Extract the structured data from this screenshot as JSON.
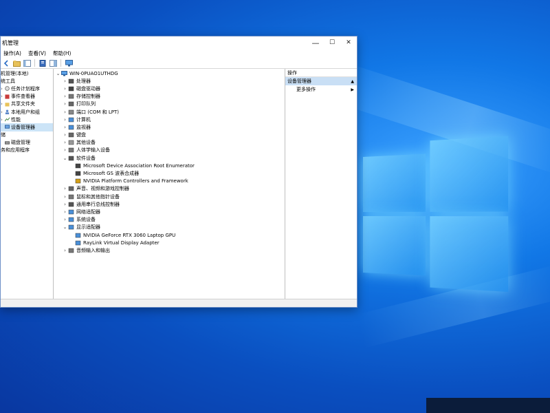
{
  "window": {
    "title": "机管理",
    "controls": {
      "minimize": "—",
      "maximize": "☐",
      "close": "✕"
    }
  },
  "menu": [
    {
      "label": "操作(A)"
    },
    {
      "label": "查看(V)"
    },
    {
      "label": "帮助(H)"
    }
  ],
  "toolbar": [
    "back-icon",
    "forward-icon",
    "up-folder-icon",
    "properties-icon",
    "help-icon",
    "show-hide-icon"
  ],
  "nav_tree": [
    {
      "label": "机管理(本地)",
      "indent": 0
    },
    {
      "label": "统工具",
      "indent": 0
    },
    {
      "label": "任务计划程序",
      "indent": 1
    },
    {
      "label": "事件查看器",
      "indent": 1
    },
    {
      "label": "共享文件夹",
      "indent": 1
    },
    {
      "label": "本地用户和组",
      "indent": 1
    },
    {
      "label": "性能",
      "indent": 1
    },
    {
      "label": "设备管理器",
      "indent": 1,
      "selected": true
    },
    {
      "label": "储",
      "indent": 0
    },
    {
      "label": "磁盘管理",
      "indent": 1
    },
    {
      "label": "务和应用程序",
      "indent": 0
    }
  ],
  "device_tree": {
    "root": "WIN-0PUAO1UTHDG",
    "items": [
      {
        "label": "处理器",
        "level": 1,
        "expanded": false
      },
      {
        "label": "磁盘驱动器",
        "level": 1,
        "expanded": false
      },
      {
        "label": "存储控制器",
        "level": 1,
        "expanded": false
      },
      {
        "label": "打印队列",
        "level": 1,
        "expanded": false
      },
      {
        "label": "端口 (COM 和 LPT)",
        "level": 1,
        "expanded": false
      },
      {
        "label": "计算机",
        "level": 1,
        "expanded": false
      },
      {
        "label": "监视器",
        "level": 1,
        "expanded": false
      },
      {
        "label": "键盘",
        "level": 1,
        "expanded": false
      },
      {
        "label": "其他设备",
        "level": 1,
        "expanded": false
      },
      {
        "label": "人体学输入设备",
        "level": 1,
        "expanded": false
      },
      {
        "label": "软件设备",
        "level": 1,
        "expanded": true
      },
      {
        "label": "Microsoft Device Association Root Enumerator",
        "level": 2
      },
      {
        "label": "Microsoft GS 波表合成器",
        "level": 2
      },
      {
        "label": "NVIDIA Platform Controllers and Framework",
        "level": 2
      },
      {
        "label": "声音、视频和游戏控制器",
        "level": 1,
        "expanded": false
      },
      {
        "label": "鼠标和其他指针设备",
        "level": 1,
        "expanded": false
      },
      {
        "label": "通用串行总线控制器",
        "level": 1,
        "expanded": false
      },
      {
        "label": "网络适配器",
        "level": 1,
        "expanded": false
      },
      {
        "label": "系统设备",
        "level": 1,
        "expanded": false
      },
      {
        "label": "显示适配器",
        "level": 1,
        "expanded": true
      },
      {
        "label": "NVIDIA GeForce RTX 3060 Laptop GPU",
        "level": 2
      },
      {
        "label": "RayLink Virtual Display Adapter",
        "level": 2
      },
      {
        "label": "音频输入和输出",
        "level": 1,
        "expanded": false
      }
    ]
  },
  "actions": {
    "header": "操作",
    "section": "设备管理器",
    "section_arrow": "▲",
    "items": [
      {
        "label": "更多操作",
        "arrow": "▶"
      }
    ]
  },
  "colors": {
    "selection": "#cce4f7",
    "action_section": "#c9dff5",
    "desktop": "#1177e6"
  }
}
